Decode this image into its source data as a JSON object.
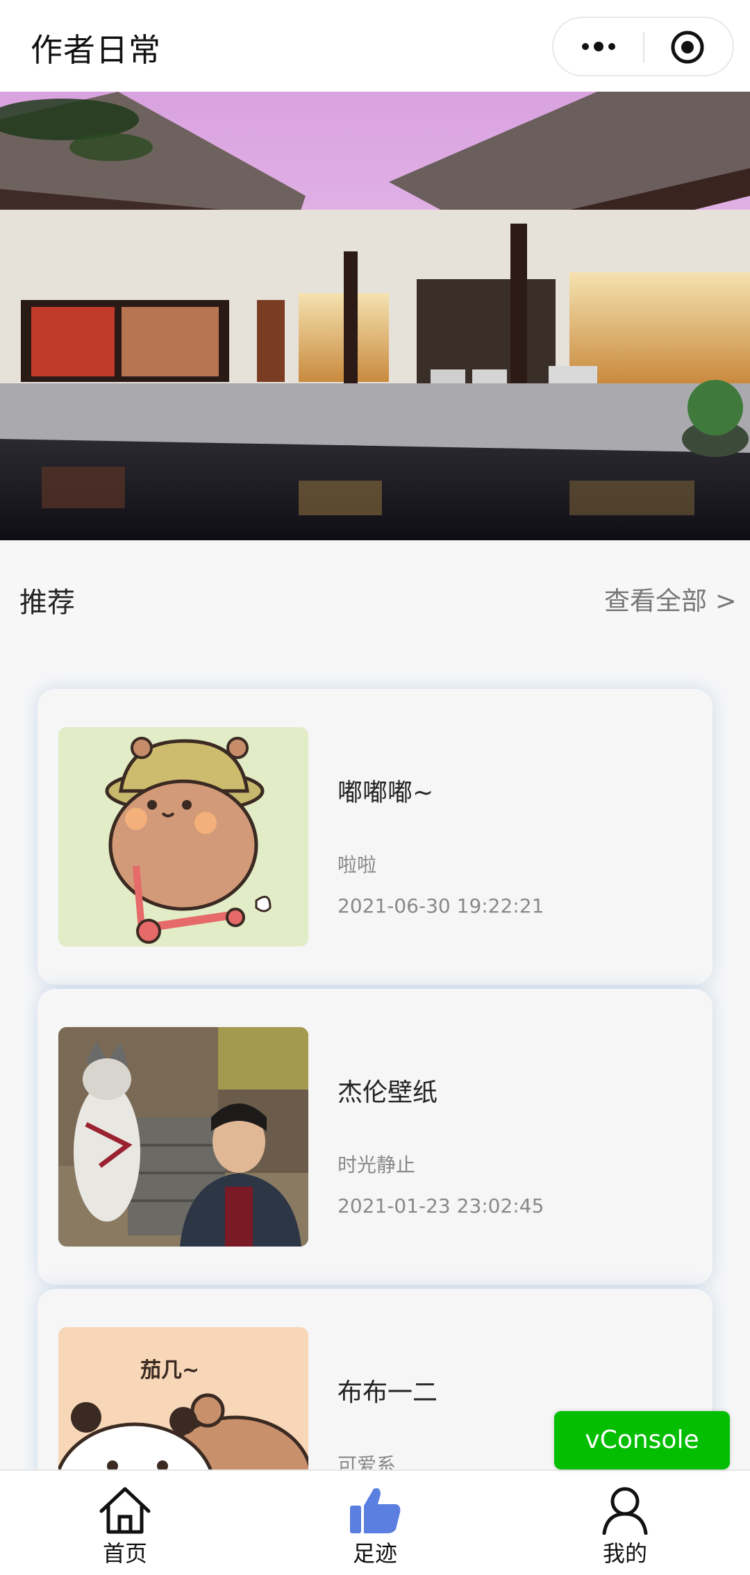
{
  "navbar": {
    "title": "作者日常",
    "more_icon": "more-dots-icon",
    "close_icon": "target-circle-icon"
  },
  "section": {
    "title": "推荐",
    "view_all": "查看全部 >"
  },
  "cards": [
    {
      "title": "嘟嘟嘟~",
      "subtitle": "啦啦",
      "date": "2021-06-30 19:22:21"
    },
    {
      "title": "杰伦壁纸",
      "subtitle": "时光静止",
      "date": "2021-01-23 23:02:45"
    },
    {
      "title": "布布一二",
      "subtitle": "可爱系",
      "date": "",
      "thumb_text": "茄几~"
    }
  ],
  "vconsole": "vConsole",
  "tabs": [
    {
      "label": "首页",
      "icon": "home-icon"
    },
    {
      "label": "足迹",
      "icon": "thumbs-up-icon"
    },
    {
      "label": "我的",
      "icon": "user-icon"
    }
  ],
  "colors": {
    "accent_green": "#04be02",
    "thumb_blue": "#5b7fe0"
  }
}
